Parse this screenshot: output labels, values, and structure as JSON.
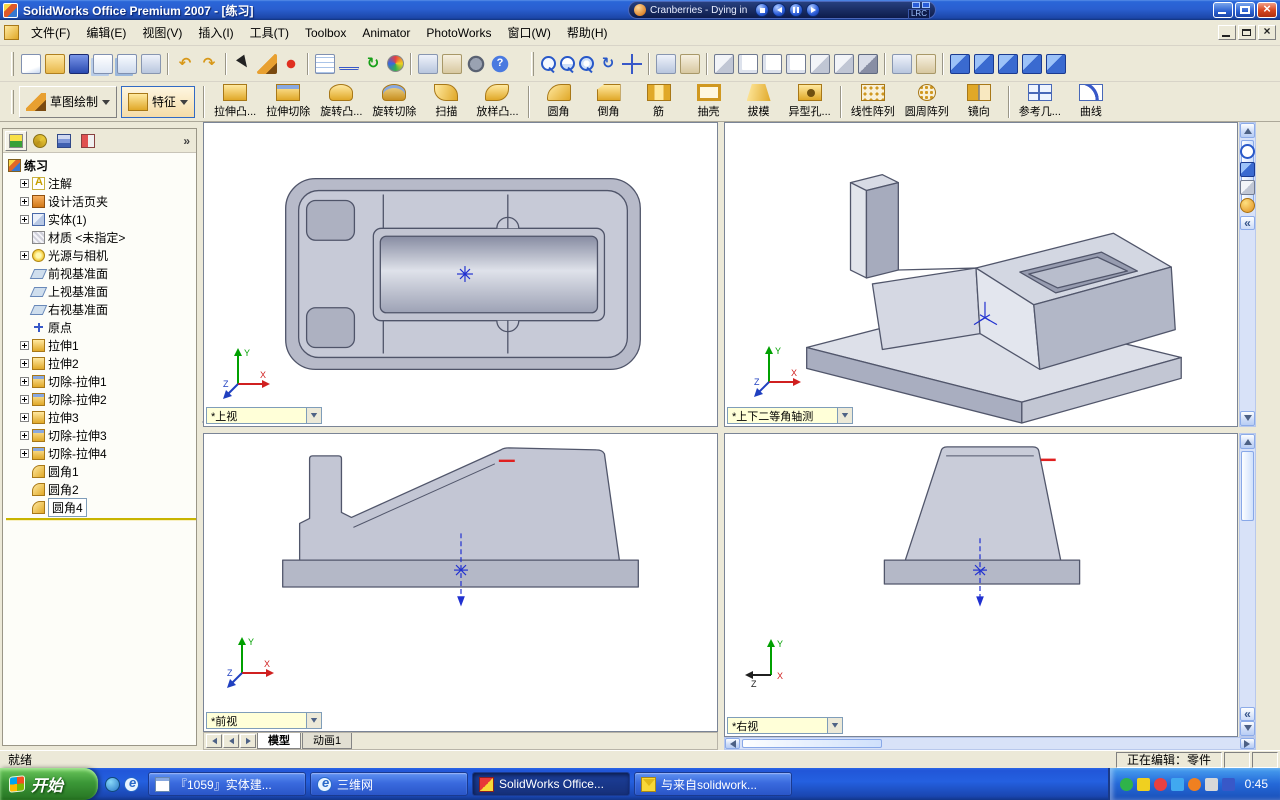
{
  "window": {
    "title": "SolidWorks Office Premium 2007 - [练习]"
  },
  "triad": {
    "x": "X",
    "y": "Y",
    "z": "Z"
  },
  "player": {
    "track": "Cranberries - Dying in",
    "lrc": "LRC",
    "buttons": [
      {
        "name": "stop"
      },
      {
        "name": "previous"
      },
      {
        "name": "pause"
      },
      {
        "name": "next"
      }
    ]
  },
  "menu": {
    "items": [
      {
        "name": "file",
        "label": "文件(F)"
      },
      {
        "name": "edit",
        "label": "编辑(E)"
      },
      {
        "name": "view",
        "label": "视图(V)"
      },
      {
        "name": "insert",
        "label": "插入(I)"
      },
      {
        "name": "tools",
        "label": "工具(T)"
      },
      {
        "name": "toolbox",
        "label": "Toolbox"
      },
      {
        "name": "animator",
        "label": "Animator"
      },
      {
        "name": "photoworks",
        "label": "PhotoWorks"
      },
      {
        "name": "window",
        "label": "窗口(W)"
      },
      {
        "name": "help",
        "label": "帮助(H)"
      }
    ]
  },
  "toolbar_main": {
    "left": [
      {
        "name": "new",
        "kind": "doc"
      },
      {
        "name": "open",
        "kind": "folder"
      },
      {
        "name": "save",
        "kind": "disk"
      },
      {
        "name": "make-drawing",
        "kind": "doc2"
      },
      {
        "name": "make-assembly",
        "kind": "doc3"
      },
      {
        "name": "print",
        "kind": "misc"
      },
      {
        "kind": "sep"
      },
      {
        "name": "undo",
        "kind": "arrl",
        "glyph": "↶"
      },
      {
        "name": "redo",
        "kind": "arrr",
        "glyph": "↷"
      },
      {
        "kind": "sep"
      },
      {
        "name": "select",
        "kind": "cursor"
      },
      {
        "name": "sketch",
        "kind": "pen"
      },
      {
        "name": "point",
        "kind": "dot"
      },
      {
        "kind": "sep"
      },
      {
        "name": "grid",
        "kind": "grid"
      },
      {
        "name": "dimension",
        "kind": "dim"
      },
      {
        "name": "rebuild",
        "kind": "rebuild",
        "glyph": "↻"
      },
      {
        "name": "edit-color",
        "kind": "palette"
      },
      {
        "kind": "sep"
      },
      {
        "name": "measure",
        "kind": "misc"
      },
      {
        "name": "mass-properties",
        "kind": "misc2"
      },
      {
        "name": "options",
        "kind": "gear"
      },
      {
        "name": "help",
        "kind": "help"
      }
    ],
    "right": [
      {
        "name": "zoom-fit",
        "kind": "mag"
      },
      {
        "name": "zoom-area",
        "kind": "mag2"
      },
      {
        "name": "zoom-in-out",
        "kind": "mag3"
      },
      {
        "name": "rotate-view",
        "kind": "rot",
        "glyph": "↻"
      },
      {
        "name": "pan",
        "kind": "pan"
      },
      {
        "kind": "sep"
      },
      {
        "name": "previous-view",
        "kind": "misc"
      },
      {
        "name": "named-views",
        "kind": "misc2"
      },
      {
        "kind": "sep"
      },
      {
        "name": "standard-views",
        "kind": "cube"
      },
      {
        "name": "wireframe",
        "kind": "cubew"
      },
      {
        "name": "hidden-lines-visible",
        "kind": "cubew"
      },
      {
        "name": "hidden-lines-removed",
        "kind": "cubew"
      },
      {
        "name": "shaded-with-edges",
        "kind": "cube"
      },
      {
        "name": "shaded",
        "kind": "cube"
      },
      {
        "name": "shadows-in-shaded-mode",
        "kind": "cubes"
      },
      {
        "kind": "sep"
      },
      {
        "name": "section-view",
        "kind": "misc"
      },
      {
        "name": "realview",
        "kind": "misc2"
      },
      {
        "kind": "sep"
      },
      {
        "name": "view-orientation",
        "kind": "cubeb"
      },
      {
        "name": "front-view",
        "kind": "cubeb"
      },
      {
        "name": "top-view",
        "kind": "cubeb"
      },
      {
        "name": "left-view",
        "kind": "cubeb"
      },
      {
        "name": "isometric-view",
        "kind": "cubeb"
      }
    ]
  },
  "toolbar_features": {
    "sketch_label": "草图绘制",
    "features_label": "特征",
    "buttons": [
      {
        "name": "extruded-boss",
        "label": "拉伸凸...",
        "kind": "boss"
      },
      {
        "name": "extruded-cut",
        "label": "拉伸切除",
        "kind": "cut"
      },
      {
        "name": "revolved-boss",
        "label": "旋转凸...",
        "kind": "rev"
      },
      {
        "name": "revolved-cut",
        "label": "旋转切除",
        "kind": "revc"
      },
      {
        "name": "sweep",
        "label": "扫描",
        "kind": "sweep"
      },
      {
        "name": "loft",
        "label": "放样凸...",
        "kind": "loft"
      },
      {
        "sep": true
      },
      {
        "name": "fillet",
        "label": "圆角",
        "kind": "fillet"
      },
      {
        "name": "chamfer",
        "label": "倒角",
        "kind": "chamfer"
      },
      {
        "name": "rib",
        "label": "筋",
        "kind": "rib"
      },
      {
        "name": "shell",
        "label": "抽壳",
        "kind": "shell"
      },
      {
        "name": "draft",
        "label": "拔模",
        "kind": "draft"
      },
      {
        "name": "hole-wizard",
        "label": "异型孔...",
        "kind": "hole"
      },
      {
        "sep": true
      },
      {
        "name": "linear-pattern",
        "label": "线性阵列",
        "kind": "lpat"
      },
      {
        "name": "circular-pattern",
        "label": "圆周阵列",
        "kind": "cpat"
      },
      {
        "name": "mirror",
        "label": "镜向",
        "kind": "mirror"
      },
      {
        "sep": true
      },
      {
        "name": "reference-geometry",
        "label": "参考几...",
        "kind": "ref"
      },
      {
        "name": "curves",
        "label": "曲线",
        "kind": "curve"
      }
    ]
  },
  "panel_tabs": {
    "items": [
      {
        "name": "featuremanager-tab",
        "kind": "1"
      },
      {
        "name": "propertymanager-tab",
        "kind": "2"
      },
      {
        "name": "configurationmanager-tab",
        "kind": "3"
      },
      {
        "name": "dimxpert-tab",
        "kind": "4"
      }
    ]
  },
  "tree": {
    "root": "练习",
    "items": [
      {
        "name": "annotations",
        "label": "注解",
        "kind": "ann",
        "plus": true
      },
      {
        "name": "design-binder",
        "label": "设计活页夹",
        "kind": "binder",
        "plus": true
      },
      {
        "name": "solid-bodies",
        "label": "实体(1)",
        "kind": "solids",
        "plus": true
      },
      {
        "name": "material",
        "label": "材质 <未指定>",
        "kind": "material",
        "plus": false
      },
      {
        "name": "lights-and-cameras",
        "label": "光源与相机",
        "kind": "lights",
        "plus": true
      },
      {
        "name": "front-plane",
        "label": "前视基准面",
        "kind": "plane",
        "plus": false
      },
      {
        "name": "top-plane",
        "label": "上视基准面",
        "kind": "plane",
        "plus": false
      },
      {
        "name": "right-plane",
        "label": "右视基准面",
        "kind": "plane",
        "plus": false
      },
      {
        "name": "origin",
        "label": "原点",
        "kind": "origin",
        "plus": false
      },
      {
        "name": "extrude1",
        "label": "拉伸1",
        "kind": "boss",
        "plus": true
      },
      {
        "name": "extrude2",
        "label": "拉伸2",
        "kind": "boss",
        "plus": true
      },
      {
        "name": "cut-extrude1",
        "label": "切除-拉伸1",
        "kind": "cut",
        "plus": true
      },
      {
        "name": "cut-extrude2",
        "label": "切除-拉伸2",
        "kind": "cut",
        "plus": true
      },
      {
        "name": "extrude3",
        "label": "拉伸3",
        "kind": "boss",
        "plus": true
      },
      {
        "name": "cut-extrude3",
        "label": "切除-拉伸3",
        "kind": "cut",
        "plus": true
      },
      {
        "name": "cut-extrude4",
        "label": "切除-拉伸4",
        "kind": "cut",
        "plus": true
      },
      {
        "name": "fillet1",
        "label": "圆角1",
        "kind": "fillet",
        "plus": false
      },
      {
        "name": "fillet2",
        "label": "圆角2",
        "kind": "fillet",
        "plus": false
      },
      {
        "name": "fillet4",
        "label": "圆角4",
        "kind": "fillet",
        "plus": false,
        "selected": true
      }
    ]
  },
  "viewports": {
    "top": {
      "label": "*上视"
    },
    "iso": {
      "label": "*上下二等角轴测"
    },
    "front": {
      "label": "*前视"
    },
    "right": {
      "label": "*右视"
    }
  },
  "model_tabs": {
    "model": "模型",
    "animation": "动画1"
  },
  "status": {
    "left": "就绪",
    "right": "正在编辑：零件"
  },
  "right_toolbar": {
    "icons": [
      {
        "name": "zoom-to-fit",
        "kind": "a"
      },
      {
        "name": "view-orientation",
        "kind": "b"
      },
      {
        "name": "display-mode",
        "kind": "c"
      },
      {
        "name": "appearance",
        "kind": "d"
      }
    ]
  },
  "taskbar": {
    "start": "开始",
    "quick_launch": [
      {
        "name": "quick-launch-media",
        "kind": "media"
      },
      {
        "name": "quick-launch-ie",
        "kind": "ie"
      }
    ],
    "tasks": [
      {
        "name": "task-1059-solid",
        "label": "『1059』实体建...",
        "kind": "note",
        "active": false
      },
      {
        "name": "task-3d-web",
        "label": "三维网",
        "kind": "ie",
        "active": false
      },
      {
        "name": "task-solidworks",
        "label": "SolidWorks Office...",
        "kind": "sw",
        "active": true
      },
      {
        "name": "task-solidworks-mail",
        "label": "与来自solidwork...",
        "kind": "mail",
        "active": false
      }
    ],
    "tray_icons": [
      "tray-icon-1",
      "tray-icon-2",
      "tray-icon-3",
      "tray-icon-4",
      "tray-icon-5",
      "tray-icon-6",
      "tray-icon-7"
    ],
    "clock": "0:45"
  }
}
